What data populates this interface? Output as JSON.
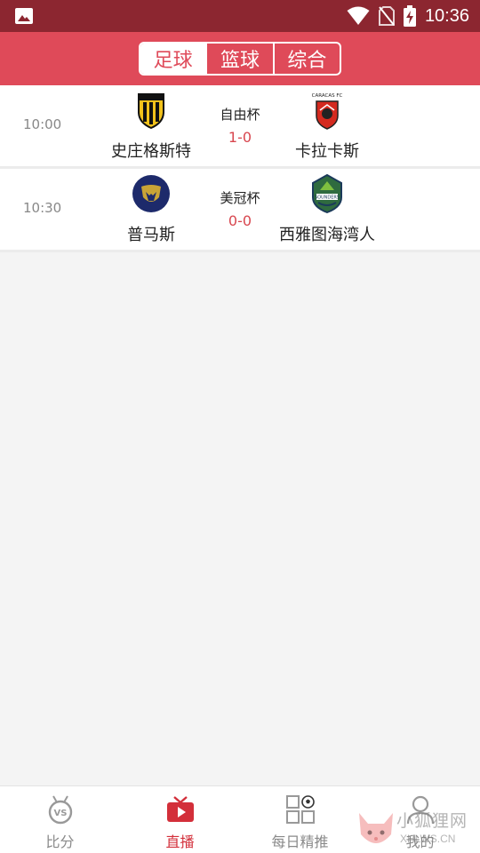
{
  "status_bar": {
    "time": "10:36",
    "icons": [
      "image-icon",
      "wifi-icon",
      "no-sim-icon",
      "battery-charging-icon"
    ]
  },
  "header": {
    "tabs": [
      {
        "label": "足球",
        "active": true
      },
      {
        "label": "篮球",
        "active": false
      },
      {
        "label": "综合",
        "active": false
      }
    ]
  },
  "matches": [
    {
      "time": "10:00",
      "league": "自由杯",
      "score": "1-0",
      "home": {
        "name": "史庄格斯特",
        "logo": "deportivo-tachira-crest"
      },
      "away": {
        "name": "卡拉卡斯",
        "logo": "caracas-fc-crest",
        "crest_text": "CARACAS FC"
      }
    },
    {
      "time": "10:30",
      "league": "美冠杯",
      "score": "0-0",
      "home": {
        "name": "普马斯",
        "logo": "pumas-crest"
      },
      "away": {
        "name": "西雅图海湾人",
        "logo": "seattle-sounders-crest",
        "crest_text": "SOUNDERS"
      }
    }
  ],
  "bottom_nav": {
    "items": [
      {
        "label": "比分",
        "icon": "vs-medal-icon",
        "active": false
      },
      {
        "label": "直播",
        "icon": "tv-play-icon",
        "active": true
      },
      {
        "label": "每日精推",
        "icon": "grid-ball-icon",
        "active": false
      },
      {
        "label": "我的",
        "icon": "user-icon",
        "active": false
      }
    ]
  },
  "watermark": {
    "text": "小狐狸网",
    "sub": "XHLWS.CN"
  },
  "colors": {
    "status_bar": "#8c2630",
    "header": "#df4a59",
    "accent": "#d32f3a",
    "score": "#d8474f"
  }
}
